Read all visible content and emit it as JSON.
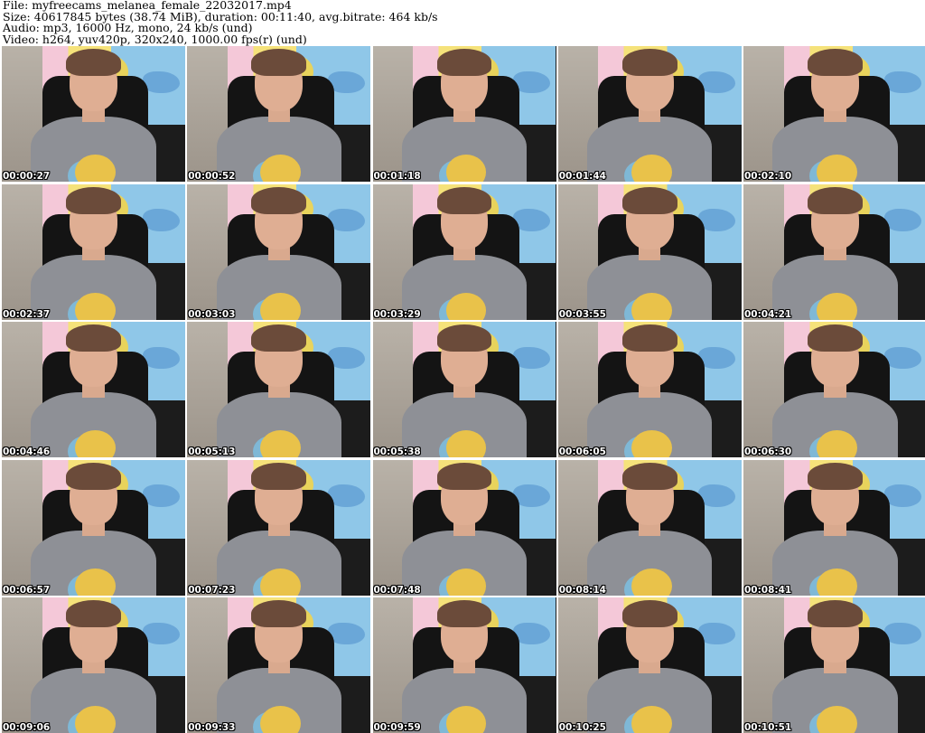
{
  "header": {
    "file_line": "File: myfreecams_melanea_female_22032017.mp4",
    "size_line": "Size: 40617845 bytes (38.74 MiB), duration: 00:11:40, avg.bitrate: 464 kb/s",
    "audio_line": "Audio: mp3, 16000 Hz, mono, 24 kb/s (und)",
    "video_line": "Video: h264, yuv420p, 320x240, 1000.00 fps(r) (und)"
  },
  "thumbnails": [
    {
      "timestamp": "00:00:27"
    },
    {
      "timestamp": "00:00:52"
    },
    {
      "timestamp": "00:01:18"
    },
    {
      "timestamp": "00:01:44"
    },
    {
      "timestamp": "00:02:10"
    },
    {
      "timestamp": "00:02:37"
    },
    {
      "timestamp": "00:03:03"
    },
    {
      "timestamp": "00:03:29"
    },
    {
      "timestamp": "00:03:55"
    },
    {
      "timestamp": "00:04:21"
    },
    {
      "timestamp": "00:04:46"
    },
    {
      "timestamp": "00:05:13"
    },
    {
      "timestamp": "00:05:38"
    },
    {
      "timestamp": "00:06:05"
    },
    {
      "timestamp": "00:06:30"
    },
    {
      "timestamp": "00:06:57"
    },
    {
      "timestamp": "00:07:23"
    },
    {
      "timestamp": "00:07:48"
    },
    {
      "timestamp": "00:08:14"
    },
    {
      "timestamp": "00:08:41"
    },
    {
      "timestamp": "00:09:06"
    },
    {
      "timestamp": "00:09:33"
    },
    {
      "timestamp": "00:09:59"
    },
    {
      "timestamp": "00:10:25"
    },
    {
      "timestamp": "00:10:51"
    }
  ]
}
